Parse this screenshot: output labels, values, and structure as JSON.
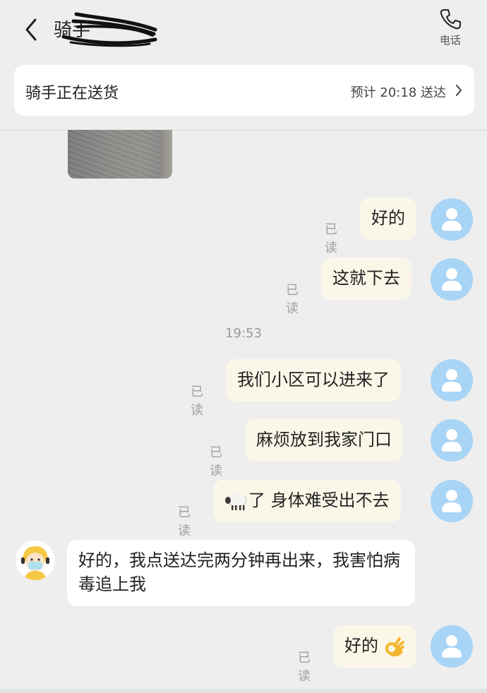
{
  "header": {
    "title": "骑手",
    "phone_label": "电话"
  },
  "status": {
    "text": "骑手正在送货",
    "eta": "预计 20:18 送达"
  },
  "messages": {
    "m1": {
      "text": "好的",
      "read": "已读"
    },
    "m2": {
      "text": "这就下去",
      "read": "已读"
    },
    "time": "19:53",
    "m3": {
      "text": "我们小区可以进来了",
      "read": "已读"
    },
    "m4": {
      "text": "麻烦放到我家门口",
      "read": "已读"
    },
    "m5": {
      "text": "了 身体难受出不去",
      "read": "已读"
    },
    "m6": {
      "text": "好的，我点送达完两分钟再出来，我害怕病毒追上我"
    },
    "m7": {
      "text": "好的",
      "read": "已读"
    }
  },
  "colors": {
    "background": "#eeeeee",
    "my_bubble": "#fbf7e8",
    "their_bubble": "#ffffff",
    "avatar": "#a8d4f6",
    "read_text": "#a0a0a0"
  },
  "icons": [
    "back-chevron-icon",
    "phone-icon",
    "chevron-right-icon",
    "sheep-emoji-icon",
    "ok-hand-emoji-icon",
    "user-avatar-icon",
    "rider-avatar-icon"
  ]
}
